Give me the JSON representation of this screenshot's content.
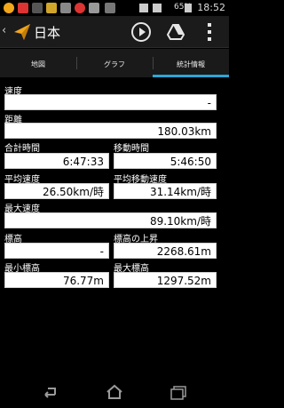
{
  "status_bar": {
    "battery": "65%",
    "time": "18:52"
  },
  "action_bar": {
    "title": "日本",
    "icons": [
      "back-chevron-icon",
      "app-logo-icon",
      "play-icon",
      "google-drive-icon",
      "overflow-menu-icon"
    ]
  },
  "tabs": [
    {
      "label": "地図",
      "active": false
    },
    {
      "label": "グラフ",
      "active": false
    },
    {
      "label": "統計情報",
      "active": true
    }
  ],
  "stats": {
    "speed": {
      "label": "速度",
      "value": "-"
    },
    "distance": {
      "label": "距離",
      "value": "180.03km"
    },
    "total_time": {
      "label": "合計時間",
      "value": "6:47:33"
    },
    "moving_time": {
      "label": "移動時間",
      "value": "5:46:50"
    },
    "avg_speed": {
      "label": "平均速度",
      "value": "26.50km/時"
    },
    "avg_moving_speed": {
      "label": "平均移動速度",
      "value": "31.14km/時"
    },
    "max_speed": {
      "label": "最大速度",
      "value": "89.10km/時"
    },
    "elevation": {
      "label": "標高",
      "value": "-"
    },
    "elevation_gain": {
      "label": "標高の上昇",
      "value": "2268.61m"
    },
    "min_elevation": {
      "label": "最小標高",
      "value": "76.77m"
    },
    "max_elevation": {
      "label": "最大標高",
      "value": "1297.52m"
    }
  },
  "colors": {
    "accent": "#2aa7d9",
    "background": "#000000",
    "field": "#ffffff"
  }
}
